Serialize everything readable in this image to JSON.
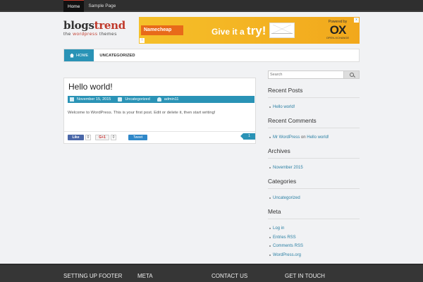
{
  "topnav": {
    "items": [
      "Home",
      "Sample Page"
    ]
  },
  "logo": {
    "brand_a": "blogs",
    "brand_b": "trend",
    "tag_a": "the ",
    "tag_b": "wordpress",
    "tag_c": " themes"
  },
  "banner": {
    "namecheap": "Namecheap",
    "give_a": "Give it a ",
    "give_b": "try!",
    "powered": "Powered by",
    "ox": "OX",
    "oxsub": "OPEN-XCHANGE",
    "close": "x",
    "info": "i"
  },
  "mainnav": {
    "home": "HOME",
    "uncategorized": "UNCATEGORIZED"
  },
  "post": {
    "title": "Hello world!",
    "date": "November 15, 2015",
    "category": "Uncategorized",
    "author": "admin11",
    "body": "Welcome to WordPress. This is your first post. Edit or delete it, then start writing!",
    "like_label": "Like",
    "like_count": "0",
    "gplus_label": "G+1",
    "gplus_count": "0",
    "tweet_label": "Tweet",
    "comment_count": "1"
  },
  "sidebar": {
    "search_placeholder": "Search",
    "recent_posts": {
      "title": "Recent Posts",
      "items": [
        "Hello world!"
      ]
    },
    "recent_comments": {
      "title": "Recent Comments",
      "author": "Mr WordPress",
      "on": " on ",
      "post": "Hello world!"
    },
    "archives": {
      "title": "Archives",
      "items": [
        "November 2015"
      ]
    },
    "categories": {
      "title": "Categories",
      "items": [
        "Uncategorized"
      ]
    },
    "meta": {
      "title": "Meta",
      "items": [
        "Log in",
        "Entries RSS",
        "Comments RSS",
        "WordPress.org"
      ]
    }
  },
  "footer": {
    "cols": [
      "SETTING UP FOOTER",
      "META",
      "CONTACT US",
      "GET IN TOUCH"
    ]
  }
}
